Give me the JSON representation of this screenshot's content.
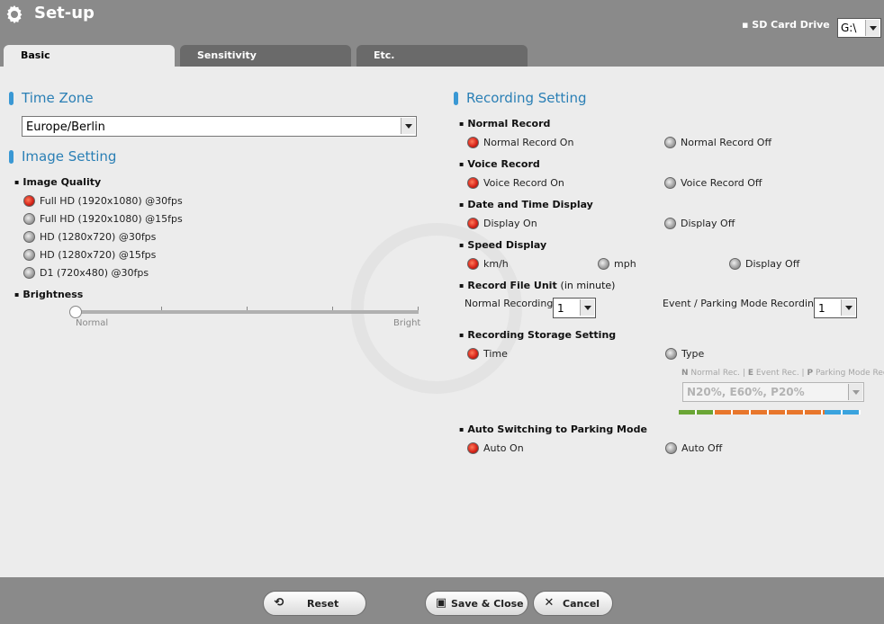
{
  "header": {
    "title": "Set-up",
    "sd_label": "▪ SD Card Drive",
    "sd_value": "G:\\"
  },
  "tabs": [
    {
      "label": "Basic",
      "active": true
    },
    {
      "label": "Sensitivity",
      "active": false
    },
    {
      "label": "Etc.",
      "active": false
    }
  ],
  "time_zone": {
    "heading": "Time Zone",
    "value": "Europe/Berlin"
  },
  "image_setting": {
    "heading": "Image Setting",
    "quality_label": "Image Quality",
    "quality_options": [
      {
        "label": "Full HD (1920x1080) @30fps",
        "selected": true
      },
      {
        "label": "Full HD (1920x1080) @15fps",
        "selected": false
      },
      {
        "label": "HD (1280x720) @30fps",
        "selected": false
      },
      {
        "label": "HD (1280x720) @15fps",
        "selected": false
      },
      {
        "label": "D1 (720x480) @30fps",
        "selected": false
      }
    ],
    "brightness_label": "Brightness",
    "brightness_min": "Normal",
    "brightness_max": "Bright",
    "brightness_level": 0
  },
  "recording": {
    "heading": "Recording Setting",
    "normal_record": {
      "label": "Normal Record",
      "on": "Normal Record On",
      "off": "Normal Record Off"
    },
    "voice_record": {
      "label": "Voice Record",
      "on": "Voice Record On",
      "off": "Voice Record Off"
    },
    "date_time": {
      "label": "Date and Time Display",
      "on": "Display On",
      "off": "Display Off"
    },
    "speed": {
      "label": "Speed Display",
      "opt1": "km/h",
      "opt2": "mph",
      "opt3": "Display Off"
    },
    "file_unit": {
      "label": "Record File Unit",
      "label_suffix": "(in minute)",
      "normal_label": "Normal Recording",
      "normal_value": "1",
      "event_label": "Event / Parking Mode Recording",
      "event_value": "1"
    },
    "storage": {
      "label": "Recording Storage Setting",
      "time": "Time",
      "type": "Type",
      "legend_n": "N",
      "legend_n_text": "Normal Rec.",
      "legend_e": "E",
      "legend_e_text": "Event Rec.",
      "legend_p": "P",
      "legend_p_text": "Parking Mode Rec.",
      "ratio_value": "N20%, E60%, P20%",
      "ratio_percent": {
        "normal": 20,
        "event": 60,
        "parking": 20
      }
    },
    "parking": {
      "label": "Auto Switching to Parking Mode",
      "on": "Auto On",
      "off": "Auto Off"
    }
  },
  "footer": {
    "reset": "Reset",
    "save": "Save & Close",
    "cancel": "Cancel"
  },
  "colors": {
    "normal": "#6aa535",
    "event": "#e8762c",
    "parking": "#3aa3de",
    "accent": "#2a7fb5"
  }
}
